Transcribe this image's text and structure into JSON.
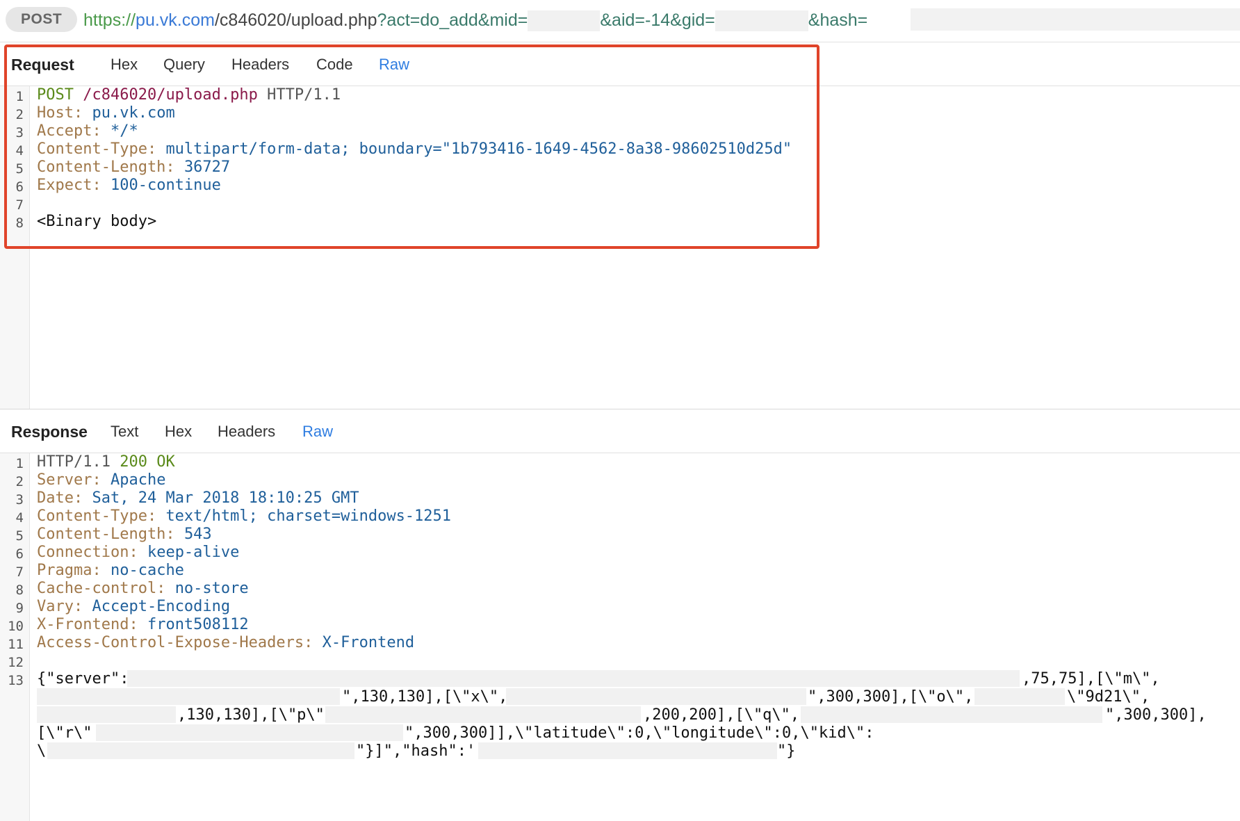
{
  "url_bar": {
    "method": "POST",
    "scheme": "https://",
    "host": "pu.vk.com",
    "path": "/c846020/upload.php",
    "query_start": "?act=do_add&mid=",
    "aid_part": "&aid=-14&gid=",
    "hash_part": "&hash="
  },
  "request": {
    "title": "Request",
    "tabs": [
      "Hex",
      "Query",
      "Headers",
      "Code",
      "Raw"
    ],
    "active_tab": "Raw",
    "line1": {
      "method": "POST",
      "path": "/c846020/upload.php",
      "proto": "HTTP/1.1"
    },
    "headers": [
      {
        "key": "Host:",
        "value": "pu.vk.com"
      },
      {
        "key": "Accept:",
        "value": "*/*"
      },
      {
        "key": "Content-Type:",
        "value": "multipart/form-data; boundary=\"1b793416-1649-4562-8a38-98602510d25d\""
      },
      {
        "key": "Content-Length:",
        "value": "36727"
      },
      {
        "key": "Expect:",
        "value": "100-continue"
      }
    ],
    "body": "<Binary body>",
    "line_numbers": [
      "1",
      "2",
      "3",
      "4",
      "5",
      "6",
      "7",
      "8"
    ]
  },
  "response": {
    "title": "Response",
    "tabs": [
      "Text",
      "Hex",
      "Headers",
      "Raw"
    ],
    "active_tab": "Raw",
    "line1": {
      "proto": "HTTP/1.1",
      "status": "200 OK"
    },
    "headers": [
      {
        "key": "Server:",
        "value": "Apache"
      },
      {
        "key": "Date:",
        "value": "Sat, 24 Mar 2018 18:10:25 GMT"
      },
      {
        "key": "Content-Type:",
        "value": "text/html; charset=windows-1251"
      },
      {
        "key": "Content-Length:",
        "value": "543"
      },
      {
        "key": "Connection:",
        "value": "keep-alive"
      },
      {
        "key": "Pragma:",
        "value": "no-cache"
      },
      {
        "key": "Cache-control:",
        "value": "no-store"
      },
      {
        "key": "Vary:",
        "value": "Accept-Encoding"
      },
      {
        "key": "X-Frontend:",
        "value": "front508112"
      },
      {
        "key": "Access-Control-Expose-Headers:",
        "value": "X-Frontend"
      }
    ],
    "body_lines": {
      "l1_a": "{\"server\":",
      "l1_b": ",75,75],[\\\"m\\\",",
      "l2_a": "\",130,130],[\\\"x\\\",",
      "l2_b": "\",300,300],[\\\"o\\\",",
      "l2_c": "\\\"9d21\\\",",
      "l3_a": ",130,130],[\\\"p\\\"",
      "l3_b": ",200,200],[\\\"q\\\",",
      "l3_c": "\",300,300],",
      "l4_a": "[\\\"r\\\"",
      "l4_b": "\",300,300]],\\\"latitude\\\":0,\\\"longitude\\\":0,\\\"kid\\\":",
      "l5_a": "\\",
      "l5_b": "\"}]\",\"hash\":'",
      "l5_c": "\"}"
    },
    "line_numbers": [
      "1",
      "2",
      "3",
      "4",
      "5",
      "6",
      "7",
      "8",
      "9",
      "10",
      "11",
      "12",
      "13"
    ]
  }
}
